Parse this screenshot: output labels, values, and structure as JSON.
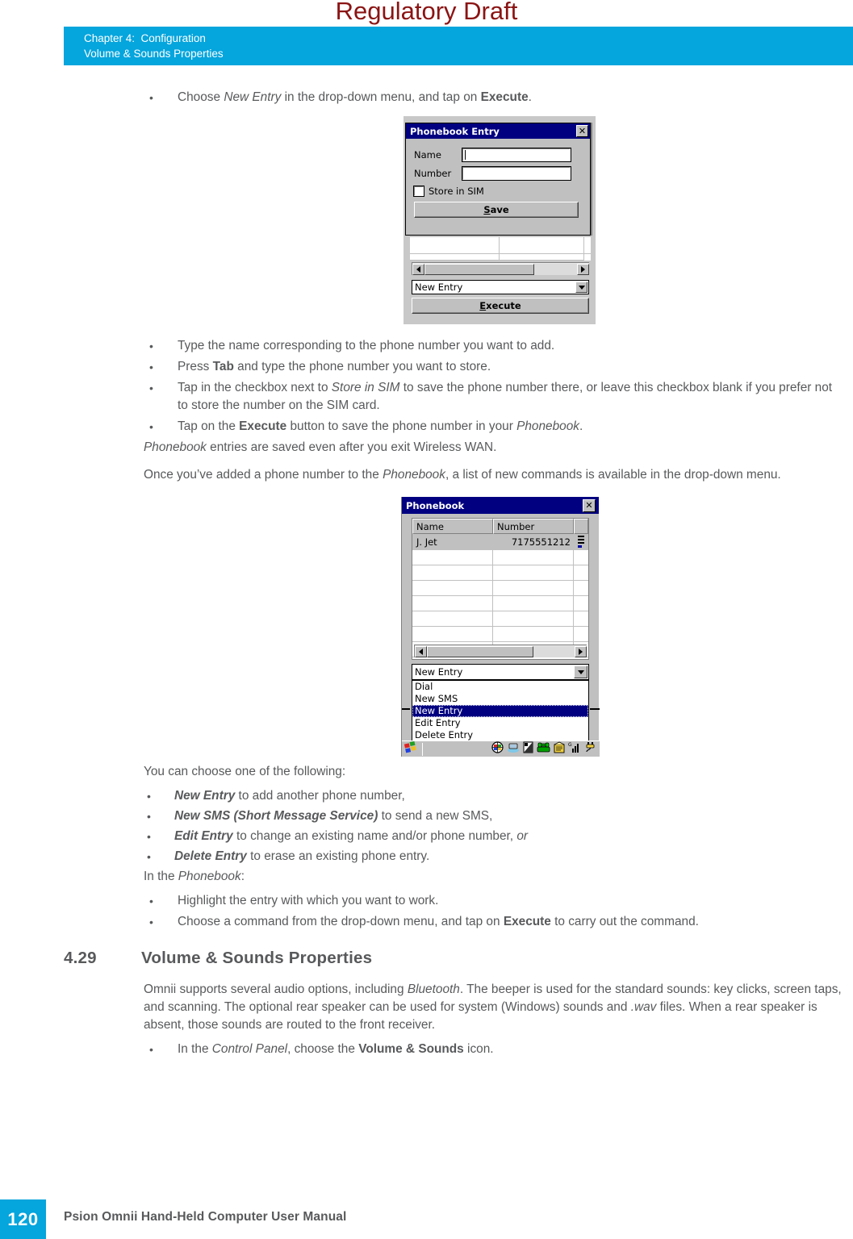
{
  "watermark": {
    "text": "Regulatory Draft",
    "color": "#8b1414"
  },
  "header": {
    "line1": "Chapter 4:  Configuration",
    "line2": "Volume & Sounds Properties",
    "bg_color": "#05a5dd",
    "text_color": "#ffffff"
  },
  "bullets_top": [
    {
      "dot": "•",
      "segments": [
        {
          "t": "Choose ",
          "s": "normal"
        },
        {
          "t": "New Entry",
          "s": "italic"
        },
        {
          "t": " in the drop-down menu, and tap on ",
          "s": "normal"
        },
        {
          "t": "Execute",
          "s": "bold"
        },
        {
          "t": ".",
          "s": "normal"
        }
      ]
    }
  ],
  "dialog1": {
    "title": "Phonebook Entry",
    "close_label": "✕",
    "name_label": "Name",
    "number_label": "Number",
    "name_value": "",
    "number_value": "",
    "checkbox_label": "Store in SIM",
    "checkbox_checked": false,
    "save_label": "Save",
    "save_mnemonic": "S",
    "combo_value": "New Entry",
    "execute_label": "Execute",
    "execute_mnemonic": "E"
  },
  "bullets_mid": [
    {
      "dot": "•",
      "segments": [
        {
          "t": "Type the name corresponding to the phone number you want to add.",
          "s": "normal"
        }
      ]
    },
    {
      "dot": "•",
      "segments": [
        {
          "t": "Press ",
          "s": "normal"
        },
        {
          "t": "Tab",
          "s": "bold"
        },
        {
          "t": " and type the phone number you want to store.",
          "s": "normal"
        }
      ]
    },
    {
      "dot": "•",
      "segments": [
        {
          "t": "Tap in the checkbox next to ",
          "s": "normal"
        },
        {
          "t": "Store in SIM",
          "s": "italic"
        },
        {
          "t": " to save the phone number there, or leave this checkbox blank if you prefer not to store the number on the SIM card.",
          "s": "normal"
        }
      ]
    },
    {
      "dot": "•",
      "segments": [
        {
          "t": "Tap on the ",
          "s": "normal"
        },
        {
          "t": "Execute",
          "s": "bold"
        },
        {
          "t": " button to save the phone number in your ",
          "s": "normal"
        },
        {
          "t": "Phonebook",
          "s": "italic"
        },
        {
          "t": ".",
          "s": "normal"
        }
      ]
    }
  ],
  "para_saved": [
    {
      "t": "Phonebook",
      "s": "italic"
    },
    {
      "t": " entries are saved even after you exit Wireless WAN.",
      "s": "normal"
    }
  ],
  "para_once": [
    {
      "t": "Once you’ve added a phone number to the ",
      "s": "normal"
    },
    {
      "t": "Phonebook",
      "s": "italic"
    },
    {
      "t": ", a list of new commands is available in the drop-down menu.",
      "s": "normal"
    }
  ],
  "dialog2": {
    "title": "Phonebook",
    "close_label": "✕",
    "columns": [
      "Name",
      "Number"
    ],
    "rows": [
      {
        "name": "J. Jet",
        "number": "7175551212",
        "selected": true
      },
      {
        "name": "",
        "number": "",
        "selected": false
      },
      {
        "name": "",
        "number": "",
        "selected": false
      },
      {
        "name": "",
        "number": "",
        "selected": false
      },
      {
        "name": "",
        "number": "",
        "selected": false
      },
      {
        "name": "",
        "number": "",
        "selected": false
      },
      {
        "name": "",
        "number": "",
        "selected": false
      },
      {
        "name": "",
        "number": "",
        "selected": false
      }
    ],
    "combo_value": "New Entry",
    "dropdown_items": [
      {
        "label": "Dial",
        "selected": false
      },
      {
        "label": "New SMS",
        "selected": false
      },
      {
        "label": "New Entry",
        "selected": true
      },
      {
        "label": "Edit Entry",
        "selected": false
      },
      {
        "label": "Delete Entry",
        "selected": false
      }
    ],
    "taskbar_icons": [
      "start-icon",
      "globe-icon",
      "desktop-icon",
      "storage-icon",
      "phone-icon",
      "modem-icon",
      "signal-bars-icon",
      "power-plug-icon"
    ]
  },
  "para_choose": [
    {
      "t": "You can choose one of the following:",
      "s": "normal"
    }
  ],
  "bullets_commands": [
    {
      "dot": "•",
      "segments": [
        {
          "t": "New Entry",
          "s": "bolditalic"
        },
        {
          "t": " to add another phone number,",
          "s": "normal"
        }
      ]
    },
    {
      "dot": "•",
      "segments": [
        {
          "t": "New SMS (Short Message Service)",
          "s": "bolditalic"
        },
        {
          "t": " to send a new SMS,",
          "s": "normal"
        }
      ]
    },
    {
      "dot": "•",
      "segments": [
        {
          "t": "Edit Entry",
          "s": "bolditalic"
        },
        {
          "t": " to change an existing name and/or phone number, ",
          "s": "normal"
        },
        {
          "t": "or",
          "s": "italic"
        }
      ]
    },
    {
      "dot": "•",
      "segments": [
        {
          "t": "Delete Entry",
          "s": "bolditalic"
        },
        {
          "t": " to erase an existing phone entry.",
          "s": "normal"
        }
      ]
    }
  ],
  "para_inthe": [
    {
      "t": "In the ",
      "s": "normal"
    },
    {
      "t": "Phonebook",
      "s": "italic"
    },
    {
      "t": ":",
      "s": "normal"
    }
  ],
  "bullets_phonebook": [
    {
      "dot": "•",
      "segments": [
        {
          "t": "Highlight the entry with which you want to work.",
          "s": "normal"
        }
      ]
    },
    {
      "dot": "•",
      "segments": [
        {
          "t": "Choose a command from the drop-down menu, and tap on ",
          "s": "normal"
        },
        {
          "t": "Execute",
          "s": "bold"
        },
        {
          "t": " to carry out the command.",
          "s": "normal"
        }
      ]
    }
  ],
  "section": {
    "number": "4.29",
    "title": "Volume & Sounds Properties"
  },
  "para_omnii": [
    {
      "t": "Omnii supports several audio options, including ",
      "s": "normal"
    },
    {
      "t": "Bluetooth",
      "s": "italic"
    },
    {
      "t": ". The beeper is used for the standard sounds: key clicks, screen taps, and scanning. The optional rear speaker can be used for system (Windows) sounds and ",
      "s": "normal"
    },
    {
      "t": ".wav",
      "s": "italic"
    },
    {
      "t": " files. When a rear speaker is absent, those sounds are routed to the front receiver.",
      "s": "normal"
    }
  ],
  "bullets_bottom": [
    {
      "dot": "•",
      "segments": [
        {
          "t": "In the ",
          "s": "normal"
        },
        {
          "t": "Control Panel",
          "s": "italic"
        },
        {
          "t": ", choose the ",
          "s": "normal"
        },
        {
          "t": "Volume & Sounds",
          "s": "bold"
        },
        {
          "t": " icon.",
          "s": "normal"
        }
      ]
    }
  ],
  "footer": {
    "page_number": "120",
    "title": "Psion Omnii Hand-Held Computer User Manual",
    "accent_color": "#05a5dd"
  }
}
